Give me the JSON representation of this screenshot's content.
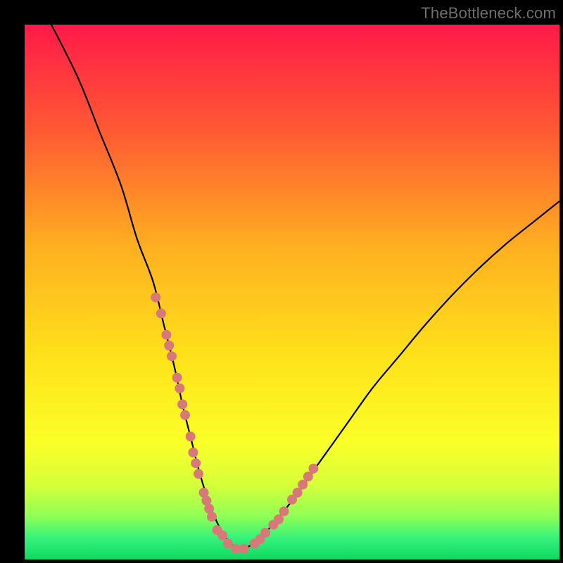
{
  "watermark": "TheBottleneck.com",
  "chart_data": {
    "type": "line",
    "title": "",
    "xlabel": "",
    "ylabel": "",
    "xlim": [
      0,
      100
    ],
    "ylim": [
      0,
      100
    ],
    "grid": false,
    "legend": false,
    "gradient_stops": [
      {
        "offset": 0.0,
        "color": "#ff1a49"
      },
      {
        "offset": 0.2,
        "color": "#ff5a33"
      },
      {
        "offset": 0.42,
        "color": "#ffb120"
      },
      {
        "offset": 0.62,
        "color": "#ffe11a"
      },
      {
        "offset": 0.78,
        "color": "#fbff28"
      },
      {
        "offset": 0.86,
        "color": "#d6ff3a"
      },
      {
        "offset": 0.92,
        "color": "#8eff56"
      },
      {
        "offset": 0.96,
        "color": "#35f27a"
      },
      {
        "offset": 1.0,
        "color": "#0fd861"
      }
    ],
    "series": [
      {
        "name": "bottleneck-curve",
        "color": "#000000",
        "x": [
          5,
          10,
          14,
          18,
          21,
          24,
          26,
          28,
          29.5,
          31,
          32.5,
          34,
          35.5,
          37,
          38.5,
          40,
          42,
          45,
          50,
          55,
          60,
          65,
          70,
          75,
          80,
          85,
          90,
          95,
          100
        ],
        "y": [
          100,
          90,
          80,
          70,
          60,
          52,
          44,
          36,
          29,
          23,
          17,
          12,
          8,
          5,
          3,
          2,
          2.5,
          5,
          11,
          18,
          25,
          32,
          38,
          44,
          49.5,
          54.5,
          59,
          63,
          67
        ]
      }
    ],
    "points": {
      "name": "highlighted-points",
      "color": "#d97878",
      "radius": 7,
      "x": [
        24.5,
        25.5,
        26.5,
        27,
        27.5,
        28.5,
        29,
        29.5,
        30,
        31,
        31.5,
        32,
        32.5,
        33.5,
        34,
        34.5,
        35,
        36,
        37,
        38,
        39.5,
        41,
        43,
        44,
        45,
        46.5,
        47.5,
        48.5,
        50,
        51,
        52,
        53,
        54
      ],
      "y": [
        49,
        46,
        42,
        40,
        38,
        34,
        32,
        29,
        27,
        23,
        20,
        18,
        16,
        12.5,
        11,
        9.5,
        8,
        5.5,
        4.5,
        3,
        2,
        2,
        3,
        3.8,
        5,
        6.5,
        7.5,
        9,
        11.2,
        12.5,
        14,
        15.5,
        17
      ]
    }
  }
}
